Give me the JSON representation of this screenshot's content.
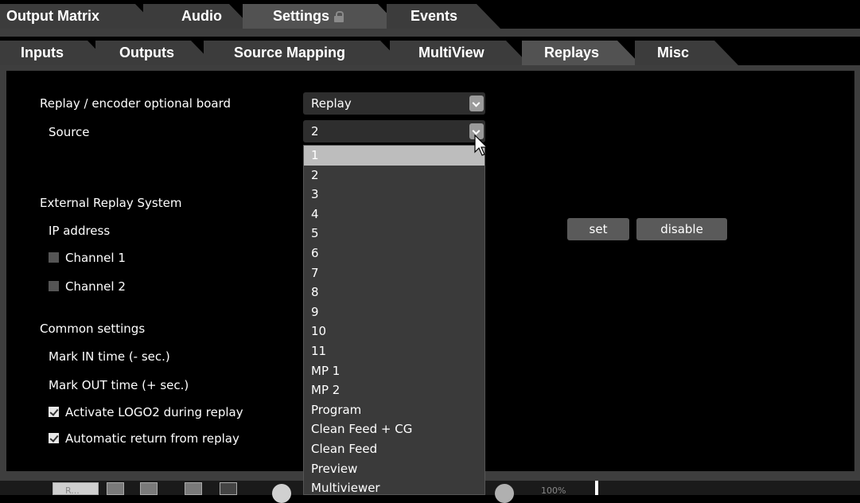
{
  "top_tabs": [
    {
      "label": "Output Matrix"
    },
    {
      "label": "Audio"
    },
    {
      "label": "Settings"
    },
    {
      "label": "Events"
    }
  ],
  "sub_tabs": [
    {
      "label": "Inputs"
    },
    {
      "label": "Outputs"
    },
    {
      "label": "Source Mapping"
    },
    {
      "label": "MultiView"
    },
    {
      "label": "Replays"
    },
    {
      "label": "Misc"
    }
  ],
  "replay": {
    "board_label": "Replay / encoder optional board",
    "board_value": "Replay",
    "source_label": "Source",
    "source_value": "2"
  },
  "external": {
    "heading": "External Replay System",
    "ip_label": "IP address",
    "channel1": "Channel 1",
    "channel2": "Channel 2",
    "set_label": "set",
    "disable_label": "disable"
  },
  "common": {
    "heading": "Common settings",
    "mark_in": "Mark IN time (- sec.)",
    "mark_out": "Mark OUT time (+ sec.)",
    "activate_logo": "Activate LOGO2 during replay",
    "auto_return": "Automatic return from replay"
  },
  "dropdown_options": [
    "1",
    "2",
    "3",
    "4",
    "5",
    "6",
    "7",
    "8",
    "9",
    "10",
    "11",
    "MP 1",
    "MP 2",
    "Program",
    "Clean Feed + CG",
    "Clean Feed",
    "Preview",
    "Multiviewer"
  ],
  "bottom": {
    "zoom_partial": "100%",
    "button_partial": "R..."
  }
}
